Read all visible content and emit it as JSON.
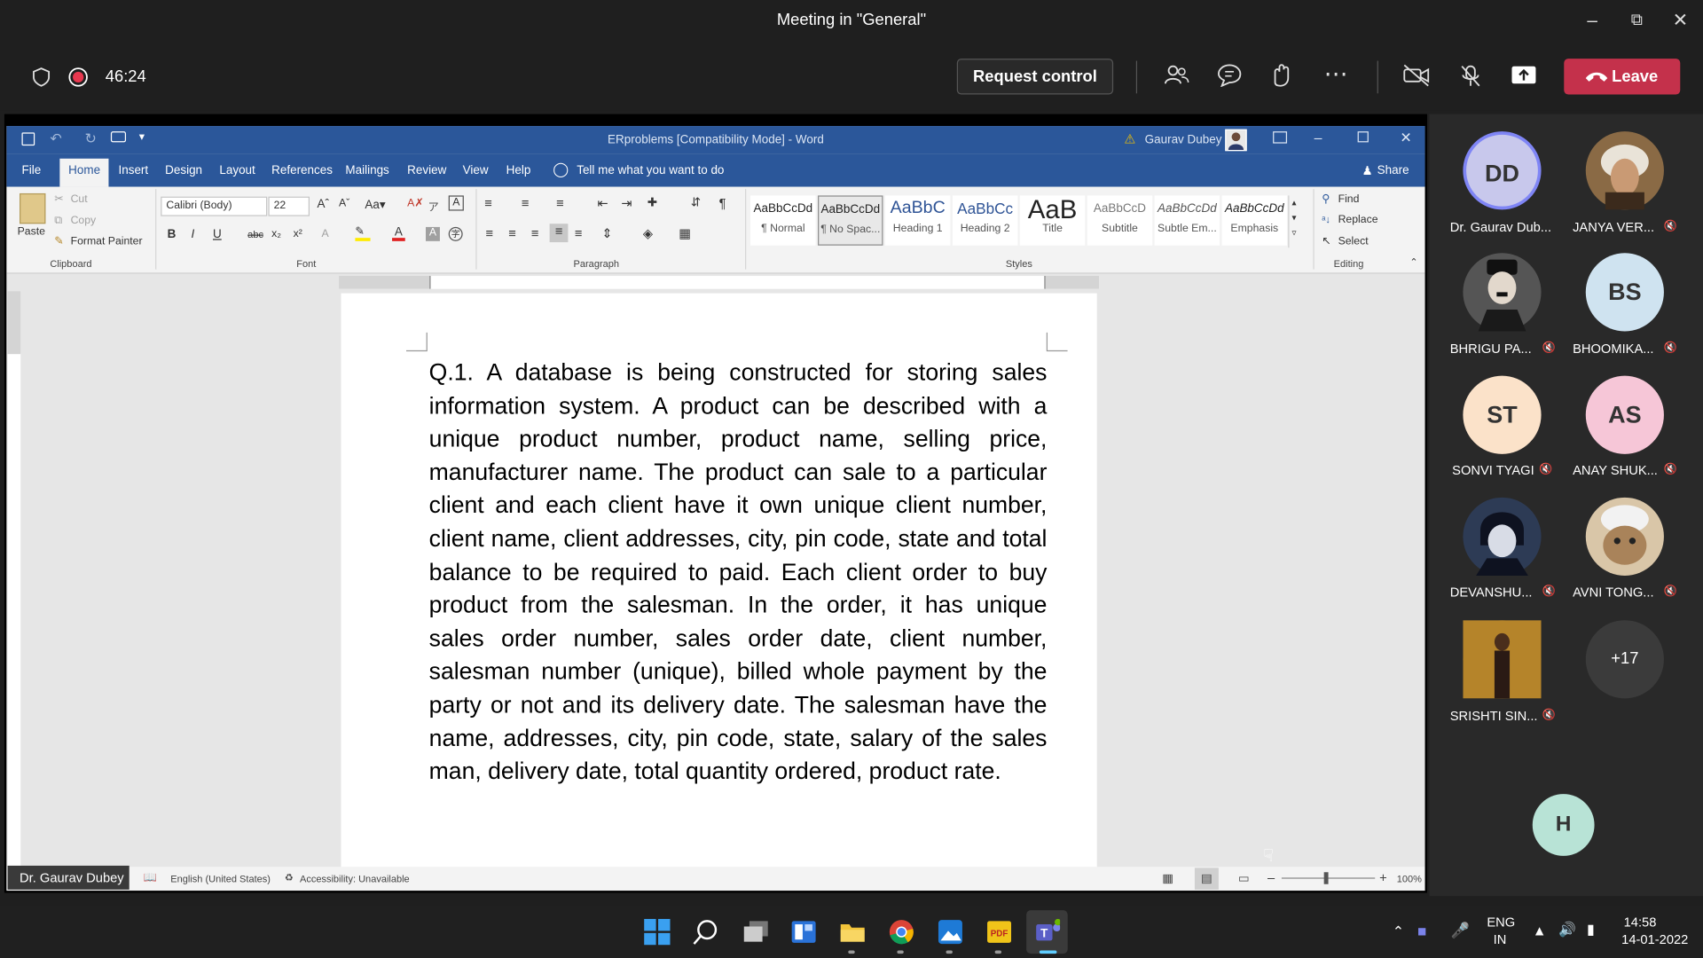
{
  "window": {
    "title": "Meeting in \"General\""
  },
  "meeting": {
    "timer": "46:24",
    "request_control": "Request control",
    "leave": "Leave"
  },
  "word": {
    "doc_title": "ERproblems [Compatibility Mode]  -  Word",
    "user": "Gaurav Dubey",
    "tabs": [
      "File",
      "Home",
      "Insert",
      "Design",
      "Layout",
      "References",
      "Mailings",
      "Review",
      "View",
      "Help"
    ],
    "tell_me": "Tell me what you want to do",
    "share": "Share",
    "clipboard": {
      "paste": "Paste",
      "cut": "Cut",
      "copy": "Copy",
      "format_painter": "Format Painter",
      "label": "Clipboard"
    },
    "font": {
      "name": "Calibri (Body)",
      "size": "22",
      "label": "Font"
    },
    "paragraph_label": "Paragraph",
    "styles": [
      {
        "preview": "AaBbCcDd",
        "name": "¶ Normal"
      },
      {
        "preview": "AaBbCcDd",
        "name": "¶ No Spac..."
      },
      {
        "preview": "AaBbC",
        "name": "Heading 1"
      },
      {
        "preview": "AaBbCc",
        "name": "Heading 2"
      },
      {
        "preview": "AaB",
        "name": "Title"
      },
      {
        "preview": "AaBbCcD",
        "name": "Subtitle"
      },
      {
        "preview": "AaBbCcDd",
        "name": "Subtle Em..."
      },
      {
        "preview": "AaBbCcDd",
        "name": "Emphasis"
      }
    ],
    "styles_label": "Styles",
    "editing": {
      "find": "Find",
      "replace": "Replace",
      "select": "Select",
      "label": "Editing"
    },
    "document_text": "Q.1. A database is being constructed for storing sales information system. A product can be described with a unique product number, product name, selling price, manufacturer name. The product can sale to a particular client and each client have it own unique client number, client name, client addresses, city, pin code, state and total balance to be required to paid. Each client order to buy product from the salesman. In the order, it has unique sales order number, sales order date, client number, salesman number (unique), billed whole payment by the party or not and its delivery date. The salesman have the name, addresses, city, pin code, state, salary of the sales man, delivery date, total quantity ordered, product rate.",
    "status": {
      "language": "English (United States)",
      "accessibility": "Accessibility: Unavailable",
      "zoom": "100%"
    }
  },
  "presenter_tag": "Dr. Gaurav Dubey",
  "participants": [
    {
      "name": "Dr. Gaurav Dub...",
      "initials": "DD",
      "color": "#c8c8ec",
      "muted": false
    },
    {
      "name": "JANYA VER...",
      "initials": "",
      "color": "#b08a5c",
      "muted": true
    },
    {
      "name": "BHRIGU PA...",
      "initials": "",
      "color": "#444444",
      "muted": true
    },
    {
      "name": "BHOOMIKA...",
      "initials": "BS",
      "color": "#cfe3f0",
      "muted": true
    },
    {
      "name": "SONVI TYAGI",
      "initials": "ST",
      "color": "#fbe2c9",
      "muted": true
    },
    {
      "name": "ANAY SHUK...",
      "initials": "AS",
      "color": "#f6c6d7",
      "muted": true
    },
    {
      "name": "DEVANSHU...",
      "initials": "",
      "color": "#2d3b55",
      "muted": true
    },
    {
      "name": "AVNI TONG...",
      "initials": "",
      "color": "#c9a880",
      "muted": true
    },
    {
      "name": "SRISHTI SIN...",
      "initials": "",
      "color": "#8a6a30",
      "muted": true
    }
  ],
  "more_participants": "+17",
  "self_avatar": "H",
  "taskbar": {
    "lang1": "ENG",
    "lang2": "IN",
    "time": "14:58",
    "date": "14-01-2022"
  }
}
